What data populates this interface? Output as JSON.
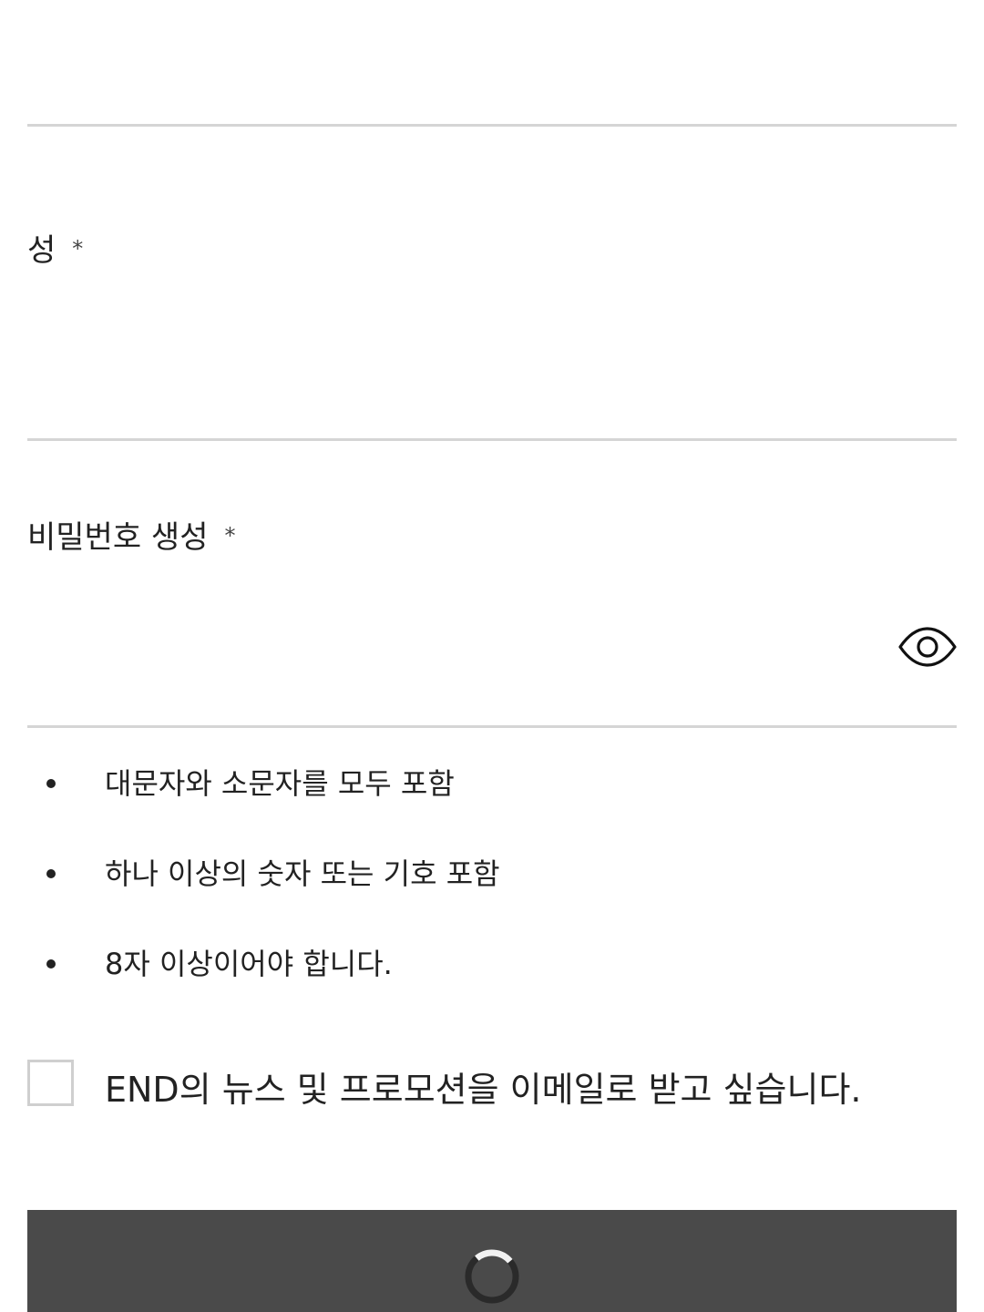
{
  "form": {
    "last_name": {
      "label": "성",
      "required_mark": "*",
      "value": ""
    },
    "password": {
      "label": "비밀번호 생성",
      "required_mark": "*",
      "value": "",
      "visibility_icon": "eye-icon"
    },
    "password_rules": [
      "대문자와 소문자를 모두 포함",
      "하나 이상의 숫자 또는 기호 포함",
      "8자 이상이어야 합니다."
    ],
    "newsletter": {
      "label": "END의 뉴스 및 프로모션을 이메일로 받고 싶습니다.",
      "checked": false
    },
    "submit": {
      "state": "loading",
      "icon": "loading-spinner-icon"
    }
  },
  "colors": {
    "text": "#222222",
    "divider": "#d5d5d5",
    "checkbox_border": "#cfcfcf",
    "button_bg": "#4a4a4a"
  }
}
